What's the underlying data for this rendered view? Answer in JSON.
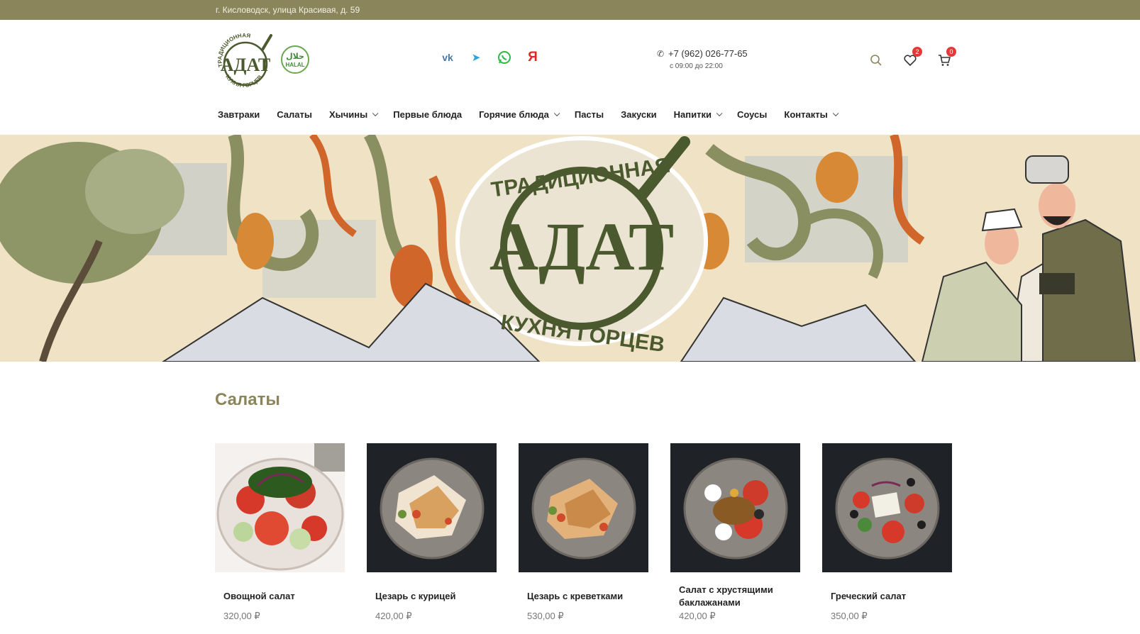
{
  "topbar": {
    "address": "г. Кисловодск, улица Красивая, д. 59"
  },
  "logo": {
    "top_text": "ТРАДИЦИОННАЯ",
    "main_text": "АДАТ",
    "bottom_text": "КУХНЯ ГОРЦЕВ",
    "halal_arabic": "حلال",
    "halal_label": "HALAL"
  },
  "socials": [
    {
      "name": "vk-icon",
      "glyph": "vk",
      "color": "#4a76a8"
    },
    {
      "name": "telegram-icon",
      "glyph": "➤",
      "color": "#2aa3df"
    },
    {
      "name": "whatsapp-icon",
      "glyph": "✆",
      "color": "#2fb845"
    },
    {
      "name": "yandex-icon",
      "glyph": "Я",
      "color": "#e52620"
    }
  ],
  "contact": {
    "phone": "+7 (962) 026-77-65",
    "hours": "с 09:00 до 22:00"
  },
  "header_icons": {
    "wishlist_count": "2",
    "cart_count": "0"
  },
  "nav": [
    {
      "label": "Завтраки",
      "dropdown": false
    },
    {
      "label": "Салаты",
      "dropdown": false
    },
    {
      "label": "Хычины",
      "dropdown": true
    },
    {
      "label": "Первые блюда",
      "dropdown": false
    },
    {
      "label": "Горячие блюда",
      "dropdown": true
    },
    {
      "label": "Пасты",
      "dropdown": false
    },
    {
      "label": "Закуски",
      "dropdown": false
    },
    {
      "label": "Напитки",
      "dropdown": true
    },
    {
      "label": "Соусы",
      "dropdown": false
    },
    {
      "label": "Контакты",
      "dropdown": true
    }
  ],
  "hero": {
    "top_text": "ТРАДИЦИОННАЯ",
    "main_text": "АДАТ",
    "bottom_text": "КУХНЯ ГОРЦЕВ"
  },
  "section": {
    "title": "Салаты"
  },
  "products": [
    {
      "name": "Овощной салат",
      "price": "320,00 ₽",
      "bg": "#ffffff"
    },
    {
      "name": "Цезарь с курицей",
      "price": "420,00 ₽",
      "bg": "#1f2226"
    },
    {
      "name": "Цезарь с креветками",
      "price": "530,00 ₽",
      "bg": "#1f2226"
    },
    {
      "name": "Салат с хрустящими баклажанами",
      "price": "420,00 ₽",
      "bg": "#1f2226"
    },
    {
      "name": "Греческий салат",
      "price": "350,00 ₽",
      "bg": "#1f2226"
    }
  ],
  "colors": {
    "brand_olive": "#8b855c",
    "logo_green": "#4b5a2e",
    "badge_red": "#e53935"
  }
}
